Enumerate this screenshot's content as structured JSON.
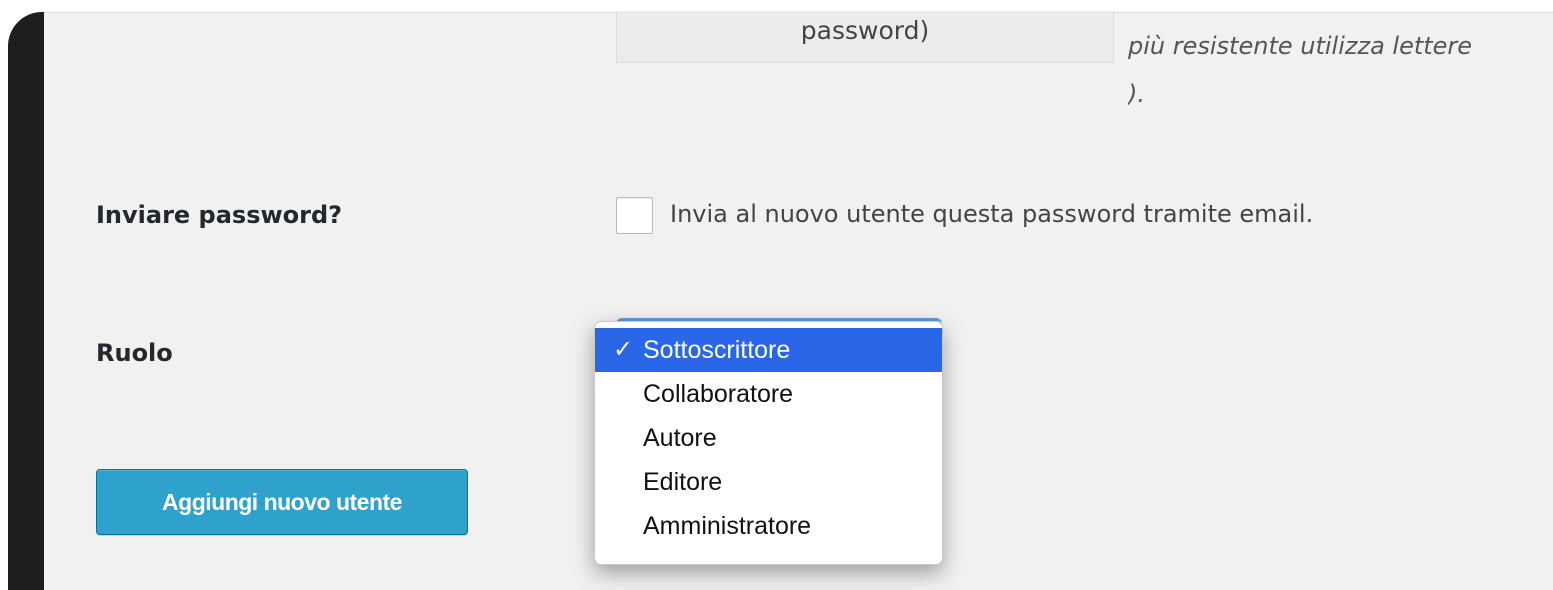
{
  "password_field": {
    "value": "password)",
    "hint_line1": "più resistente utilizza lettere",
    "hint_line2": ")."
  },
  "send_password": {
    "label": "Inviare password?",
    "checkbox_checked": false,
    "checkbox_text": "Invia al nuovo utente questa password tramite email."
  },
  "role": {
    "label": "Ruolo",
    "options": [
      "Sottoscrittore",
      "Collaboratore",
      "Autore",
      "Editore",
      "Amministratore"
    ],
    "selected_index": 0,
    "check_glyph": "✓"
  },
  "submit": {
    "label": "Aggiungi nuovo utente"
  },
  "colors": {
    "button_bg": "#2ea2cc",
    "selected_option_bg": "#2a66e8",
    "sidebar_dark": "#1e1e1e",
    "page_bg": "#f1f1f1"
  }
}
